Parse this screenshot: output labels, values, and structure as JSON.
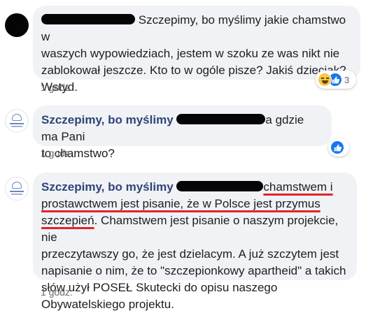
{
  "comments": [
    {
      "lines": [
        "Szczepimy, bo myślimy jakie chamstwo w",
        "waszych wypowiedziach, jestem w szoku ze was nikt nie",
        "zablokował jeszcze. Kto to w ogóle pisze? Jakiś dzieciak?",
        "Wstyd."
      ],
      "time": "1 godz.",
      "reaction_count": "3"
    },
    {
      "author": "Szczepimy, bo myślimy",
      "text_after_redaction": "a gdzie ma Pani",
      "line2": "to chamstwo?",
      "time": "1 godz."
    },
    {
      "author": "Szczepimy, bo myślimy",
      "underlined_1": "chamstwem i",
      "underlined_2": "prostawctwem jest pisanie, że w Polsce jest przymus",
      "underlined_3": "szczepień",
      "rest_3": ". Chamstwem jest pisanie o naszym projekcie, nie",
      "lines": [
        "przeczytawszy go, że jest dzielacym. A już szczytem jest",
        "napisanie o nim, że to \"szczepionkowy apartheid\" a takich",
        "słów użył POSEŁ Skutecki do opisu naszego",
        "Obywatelskiego projektu."
      ],
      "time": "1 godz."
    }
  ],
  "colors": {
    "author_name": "#2f4477",
    "underline": "#e0242b",
    "bubble": "#f0f2f5",
    "like": "#1877f2"
  },
  "icons": {
    "reactions_1": [
      "haha-icon",
      "like-icon"
    ],
    "reactions_2": [
      "like-icon"
    ]
  }
}
